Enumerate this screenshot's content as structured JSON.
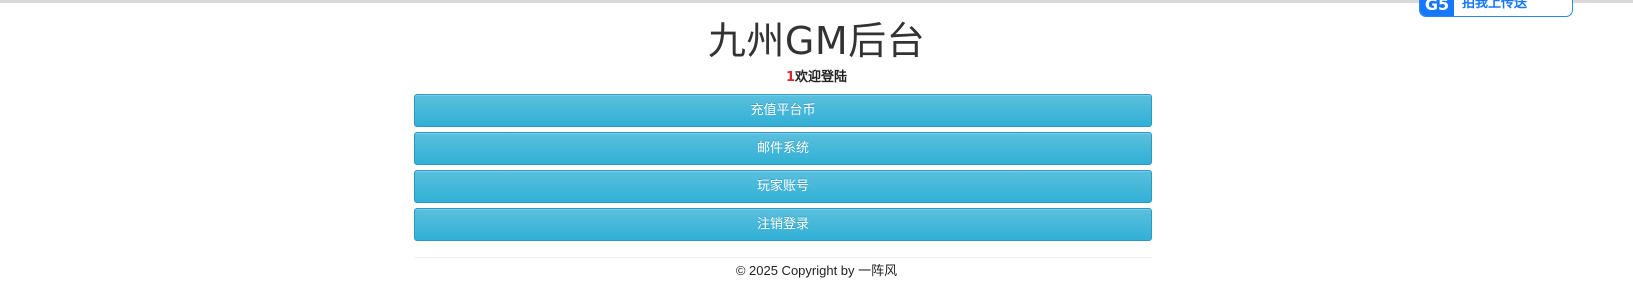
{
  "page": {
    "title": "九州GM后台",
    "welcome_uid": "1",
    "welcome_text": "欢迎登陆"
  },
  "menu": {
    "items": [
      {
        "label": "充值平台币"
      },
      {
        "label": "邮件系统"
      },
      {
        "label": "玩家账号"
      },
      {
        "label": "注销登录"
      }
    ]
  },
  "footer": {
    "copyright": "© 2025 Copyright by 一阵风"
  },
  "badge": {
    "logo": "G5",
    "text": "拍我上传送"
  },
  "colors": {
    "button_bg": "#5bc0de",
    "button_border": "#2a9ac2",
    "uid_red": "#d9262c",
    "badge_blue": "#1677ff"
  }
}
